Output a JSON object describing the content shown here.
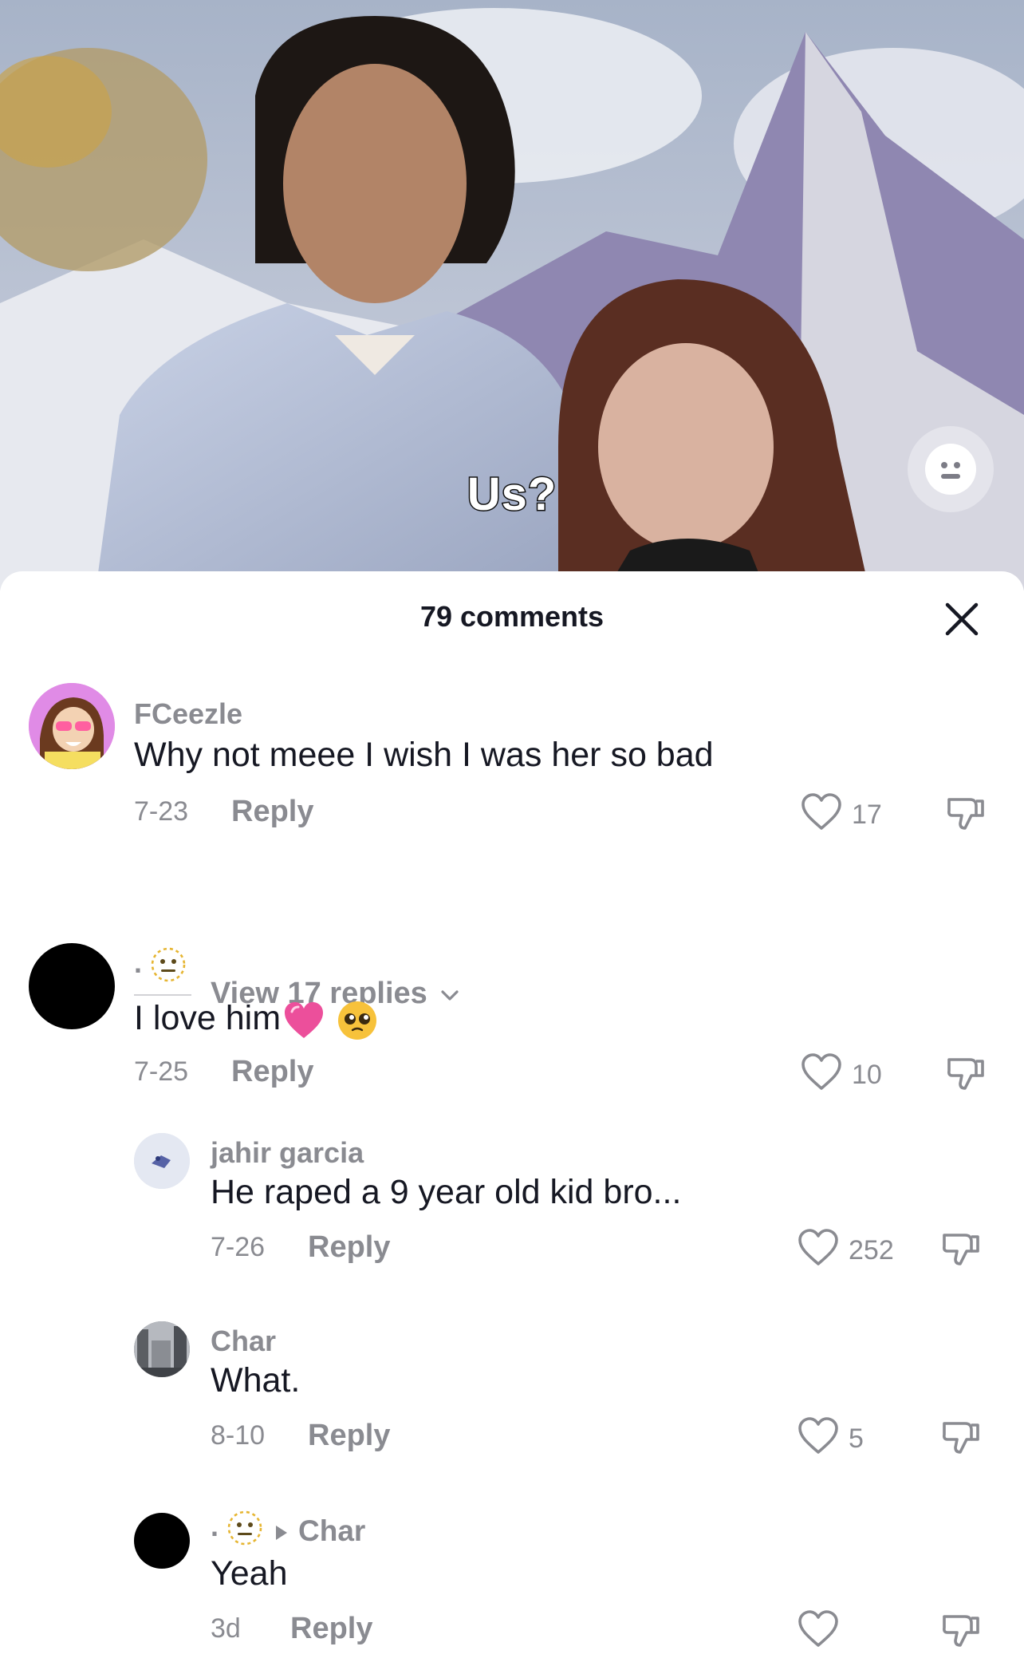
{
  "video": {
    "caption": "Us?"
  },
  "sheet": {
    "title": "79 comments"
  },
  "comments": [
    {
      "username": "FCeezle",
      "text": "Why not meee I wish I was her so bad",
      "date": "7-23",
      "reply_label": "Reply",
      "likes": "17",
      "view_replies": "View 17 replies"
    },
    {
      "username": ".",
      "text": "I love him",
      "date": "7-25",
      "reply_label": "Reply",
      "likes": "10"
    },
    {
      "username": "jahir garcia",
      "text": "He raped a 9 year old kid bro...",
      "date": "7-26",
      "reply_label": "Reply",
      "likes": "252"
    },
    {
      "username": "Char",
      "text": "What.",
      "date": "8-10",
      "reply_label": "Reply",
      "likes": "5"
    },
    {
      "username": ".",
      "reply_to": "Char",
      "text": "Yeah",
      "date": "3d",
      "reply_label": "Reply",
      "likes": ""
    }
  ],
  "colors": {
    "primary_text": "#161823",
    "secondary_text": "#8a8b91",
    "like_icon": "#8a8b91"
  },
  "icons": [
    "emoji-face-icon",
    "close-icon",
    "heart-icon",
    "dislike-icon",
    "chevron-down-icon",
    "pink-heart-emoji",
    "pleading-face-emoji",
    "dotted-face-emoji",
    "play-arrow-icon"
  ]
}
